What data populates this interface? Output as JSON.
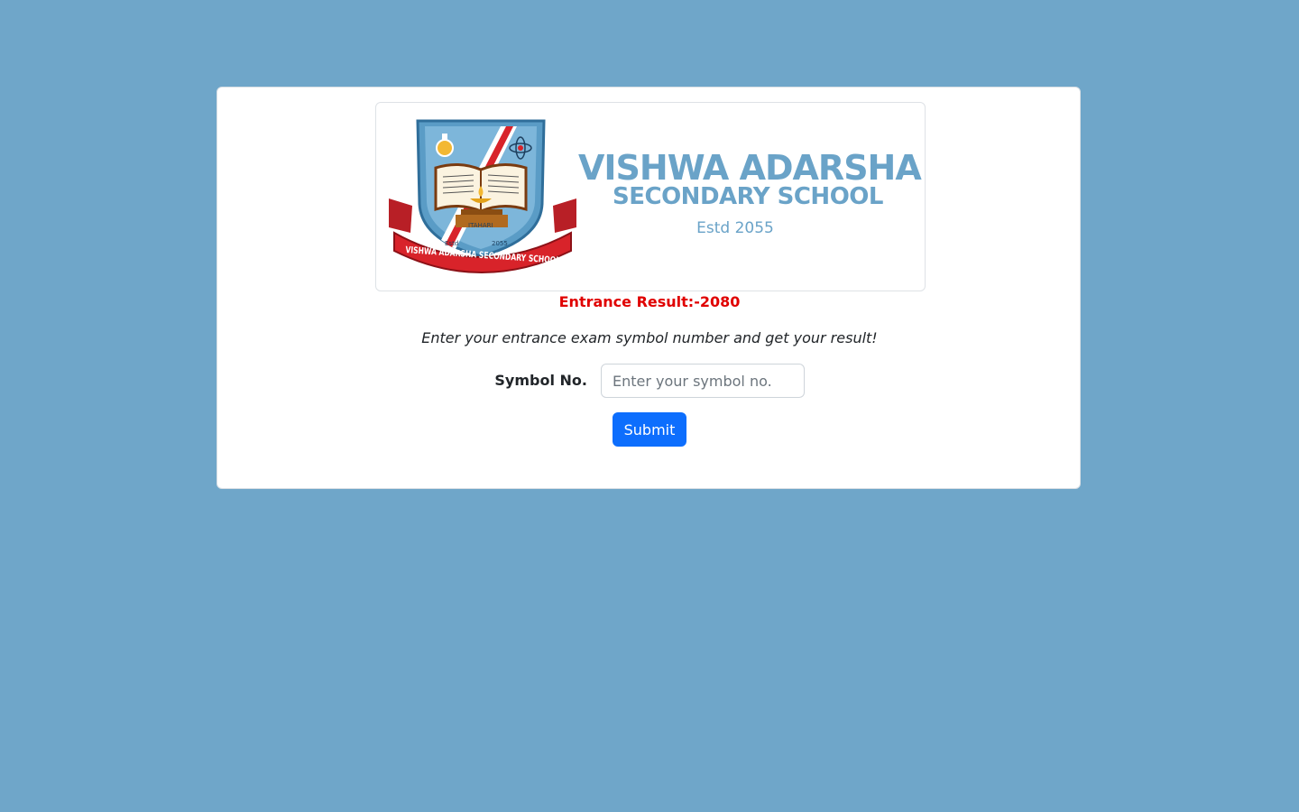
{
  "banner": {
    "school_name": "VISHWA ADARSHA",
    "school_sub": "SECONDARY SCHOOL",
    "estd": "Estd 2055",
    "crest": {
      "icon": "school-crest-logo",
      "ribbon_text": "VISHWA ADARSHA SECONDARY SCHOOL",
      "city_text": "ITAHARI",
      "estd_label": "Estd",
      "estd_year": "2055"
    }
  },
  "result_title": "Entrance Result:-2080",
  "instruction": "Enter your entrance exam symbol number and get your result!",
  "form": {
    "symbol_label": "Symbol No.",
    "symbol_value": "",
    "symbol_placeholder": "Enter your symbol no.",
    "submit_label": "Submit"
  },
  "colors": {
    "background": "#6fa6c9",
    "brand": "#6aa3c8",
    "result_title": "#e00000",
    "button": "#0d6efd"
  }
}
